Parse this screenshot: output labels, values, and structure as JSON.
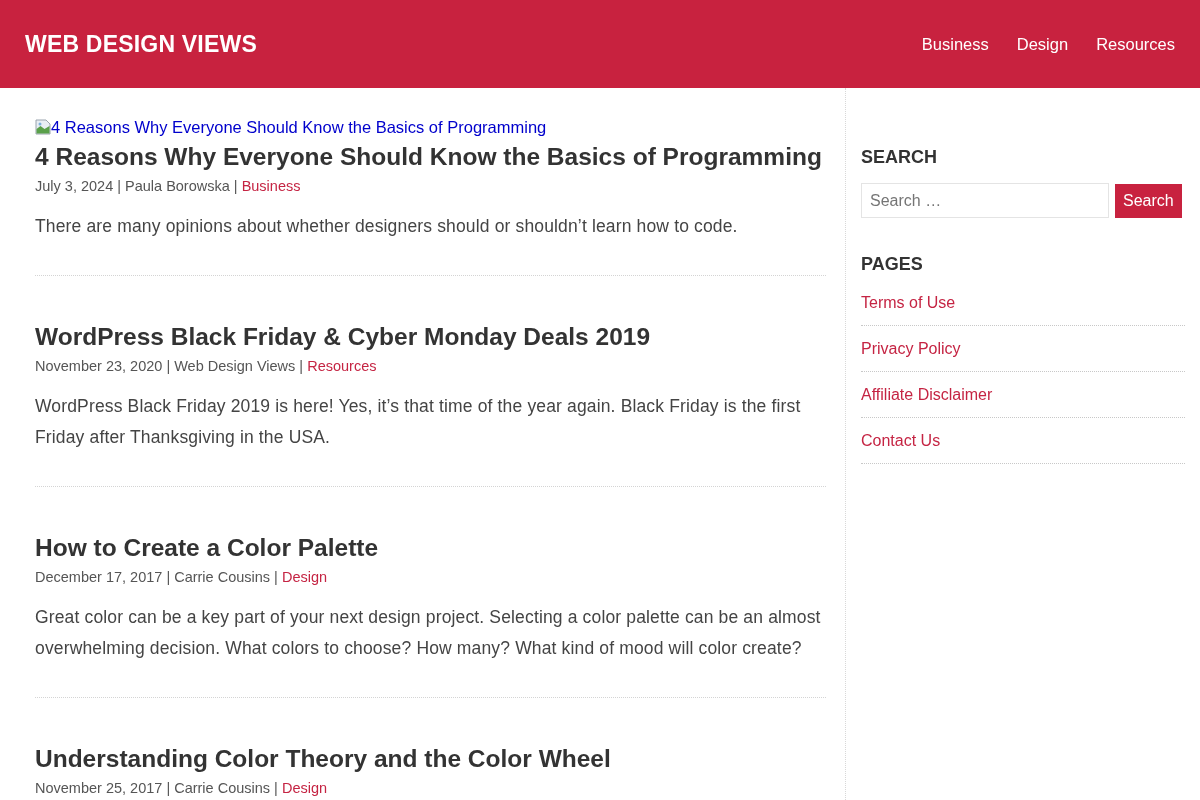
{
  "header": {
    "site_title": "WEB DESIGN VIEWS",
    "nav": [
      "Business",
      "Design",
      "Resources"
    ]
  },
  "posts": [
    {
      "image_alt": "4 Reasons Why Everyone Should Know the Basics of Programming",
      "title": "4 Reasons Why Everyone Should Know the Basics of Programming",
      "byline": "July 3, 2024 | Paula Borowska |",
      "category": "Business",
      "excerpt": "There are many opinions about whether designers should or shouldn’t learn how to code."
    },
    {
      "title": "WordPress Black Friday & Cyber Monday Deals 2019",
      "byline": "November 23, 2020 | Web Design Views |",
      "category": "Resources",
      "excerpt": "WordPress Black Friday 2019 is here! Yes, it’s that time of the year again. Black Friday is the first Friday after Thanksgiving in the USA."
    },
    {
      "title": "How to Create a Color Palette",
      "byline": "December 17, 2017 | Carrie Cousins |",
      "category": "Design",
      "excerpt": "Great color can be a key part of your next design project. Selecting a color palette can be an almost overwhelming decision. What colors to choose? How many? What kind of mood will color create?"
    },
    {
      "title": "Understanding Color Theory and the Color Wheel",
      "byline": "November 25, 2017 | Carrie Cousins |",
      "category": "Design"
    }
  ],
  "sidebar": {
    "search": {
      "heading": "SEARCH",
      "placeholder": "Search …",
      "button": "Search"
    },
    "pages": {
      "heading": "PAGES",
      "links": [
        "Terms of Use",
        "Privacy Policy",
        "Affiliate Disclaimer",
        "Contact Us"
      ]
    }
  }
}
